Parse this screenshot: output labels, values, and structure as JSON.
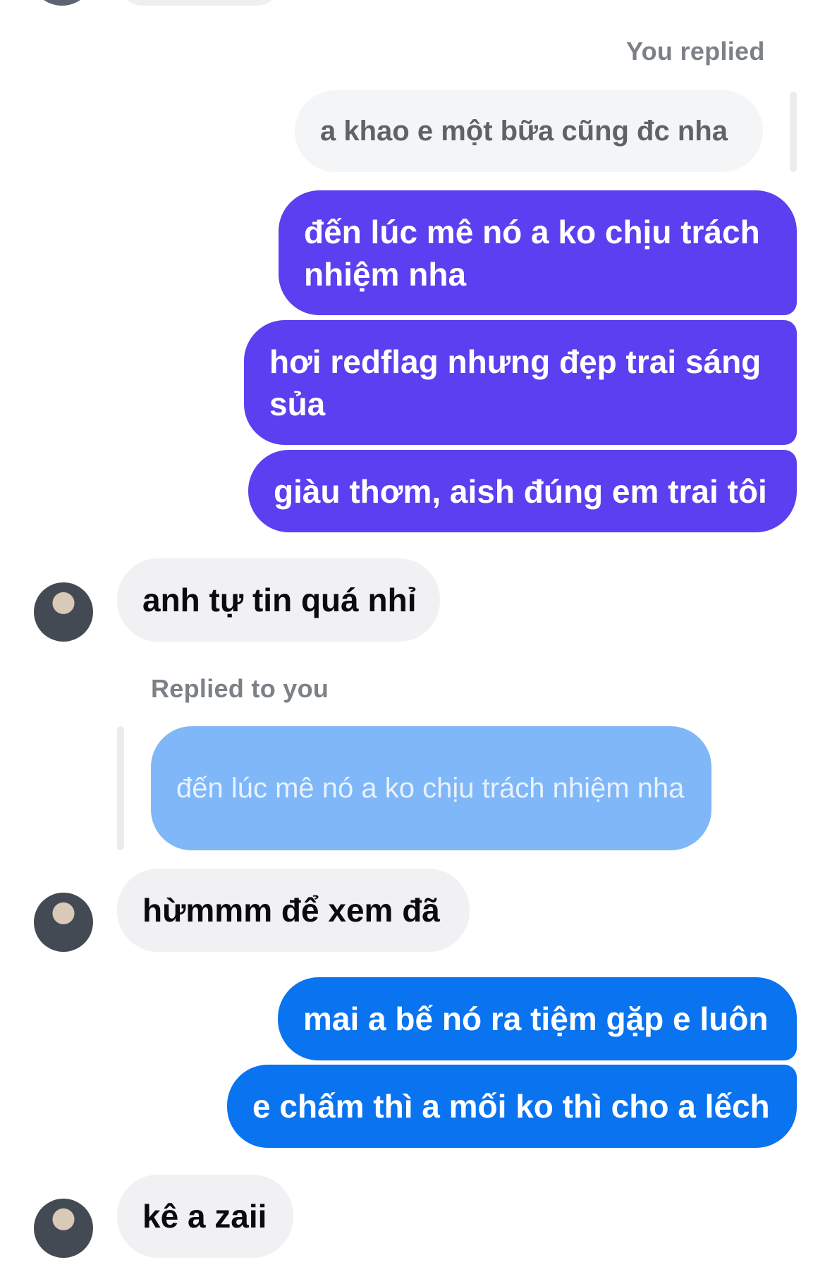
{
  "conversation": {
    "you_replied_label": "You replied",
    "quoted_own": "a khao e một bữa cũng đc nha",
    "outgoing_purple": [
      "đến lúc mê nó a ko chịu trách nhiệm nha",
      "hơi redflag nhưng đẹp trai sáng sủa",
      "giàu thơm, aish đúng em trai tôi"
    ],
    "incoming_1": "anh tự tin quá nhỉ",
    "replied_to_you_label": "Replied to you",
    "quoted_from_you": "đến lúc mê nó a ko chịu trách nhiệm nha",
    "incoming_2": "hừmmm để xem đã",
    "outgoing_blue": [
      "mai a bế nó ra tiệm gặp e luôn",
      "e chấm thì a mối ko thì cho a lếch"
    ],
    "incoming_3": "kê a zaii"
  },
  "colors": {
    "purple_bubble": "#5b3ff0",
    "blue_bubble": "#0a73f0",
    "incoming_bubble": "#f1f1f4",
    "quoted_light_blue": "#7fb7f8"
  },
  "icons": {
    "avatar": "contact-avatar"
  }
}
